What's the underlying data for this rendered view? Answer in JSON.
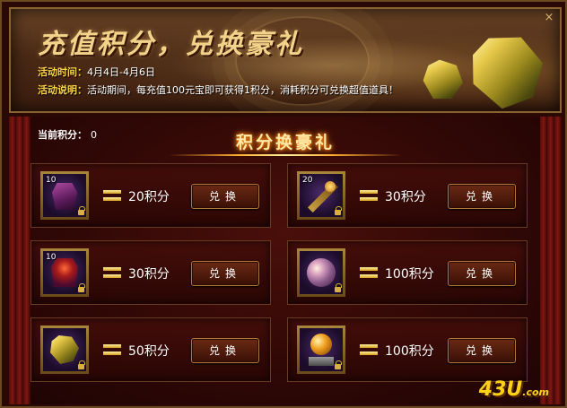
{
  "banner": {
    "title": "充值积分，兑换豪礼",
    "time_label": "活动时间：",
    "time_value": "4月4日-4月6日",
    "desc_label": "活动说明：",
    "desc_value": "活动期间，每充值100元宝即可获得1积分，消耗积分可兑换超值道具！",
    "close_icon": "×"
  },
  "points": {
    "label": "当前积分：",
    "value": "0"
  },
  "section_title": "积分换豪礼",
  "rewards": [
    {
      "icon": "purple-armor-icon",
      "count": "10",
      "cost": "20积分",
      "button": "兑换"
    },
    {
      "icon": "golden-staff-icon",
      "count": "20",
      "cost": "30积分",
      "button": "兑换"
    },
    {
      "icon": "crimson-armor-icon",
      "count": "10",
      "cost": "30积分",
      "button": "兑换"
    },
    {
      "icon": "crystal-orb-icon",
      "count": "",
      "cost": "100积分",
      "button": "兑换"
    },
    {
      "icon": "yellow-gem-icon",
      "count": "",
      "cost": "50积分",
      "button": "兑换"
    },
    {
      "icon": "golden-orb-pedestal-icon",
      "count": "",
      "cost": "100积分",
      "button": "兑换"
    }
  ],
  "logo": {
    "main": "43U",
    "suffix": ".com"
  }
}
